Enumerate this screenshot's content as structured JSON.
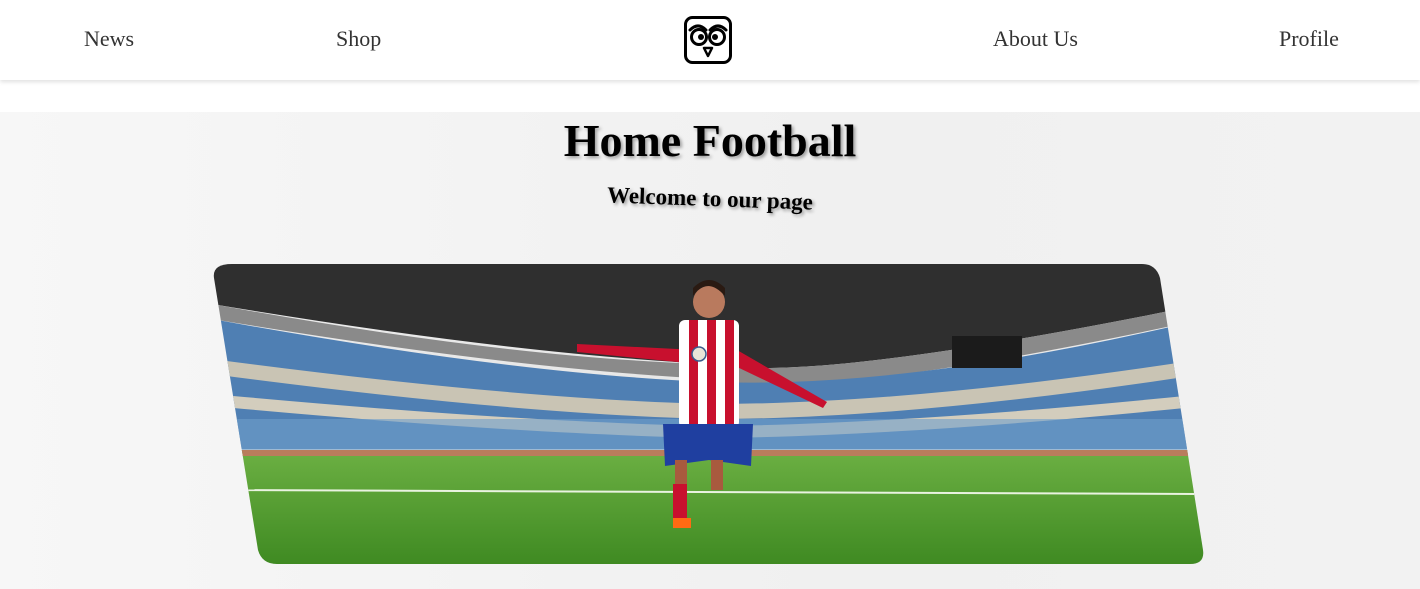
{
  "nav": {
    "news": "News",
    "shop": "Shop",
    "about": "About Us",
    "profile": "Profile",
    "logo_icon": "owl-logo-icon"
  },
  "hero": {
    "title": "Home Football",
    "subtitle": "Welcome to our page",
    "banner_image": "football-player-stadium-image"
  },
  "colors": {
    "nav_text": "#333333",
    "hero_bg": "#f2f2f2",
    "heading": "#000000",
    "pitch": "#4e9a2c",
    "seats": "#5b8fbf",
    "jersey_red": "#c8102e",
    "shorts": "#1f3fa0"
  }
}
